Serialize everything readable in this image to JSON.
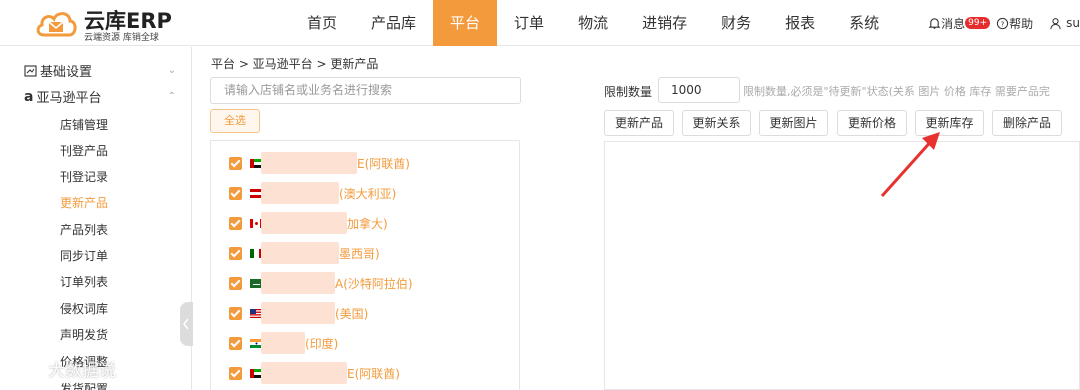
{
  "logo": {
    "title": "云库ERP",
    "subtitle": "云端资源 库销全球"
  },
  "nav": [
    "首页",
    "产品库",
    "平台",
    "订单",
    "物流",
    "进销存",
    "财务",
    "报表",
    "系统"
  ],
  "nav_active_index": 2,
  "topbar": {
    "messages": "消息",
    "badge": "99+",
    "help": "帮助",
    "user": "su"
  },
  "sidebar": {
    "groups": [
      "基础设置",
      "亚马逊平台"
    ],
    "items": [
      "店铺管理",
      "刊登产品",
      "刊登记录",
      "更新产品",
      "产品列表",
      "同步订单",
      "订单列表",
      "侵权词库",
      "声明发货",
      "价格调整"
    ],
    "active_item": "更新产品",
    "cut_item": "发货配置"
  },
  "breadcrumb": "平台 > 亚马逊平台 > 更新产品",
  "search": {
    "placeholder": "请输入店铺名或业务名进行搜索"
  },
  "select_all": "全选",
  "shops": [
    {
      "suffix": "E(阿联酋)"
    },
    {
      "suffix": "(澳大利亚)"
    },
    {
      "suffix": "加拿大)"
    },
    {
      "suffix": "墨西哥)"
    },
    {
      "suffix": "A(沙特阿拉伯)"
    },
    {
      "suffix": "(美国)"
    },
    {
      "suffix": "(印度)"
    },
    {
      "suffix": "E(阿联酋)"
    }
  ],
  "limit": {
    "label": "限制数量",
    "value": "1000",
    "hint": "限制数量,必须是\"待更新\"状态(关系 图片 价格 库存 需要产品完"
  },
  "actions": [
    "更新产品",
    "更新关系",
    "更新图片",
    "更新价格",
    "更新库存",
    "删除产品"
  ],
  "watermark": "大数据说"
}
